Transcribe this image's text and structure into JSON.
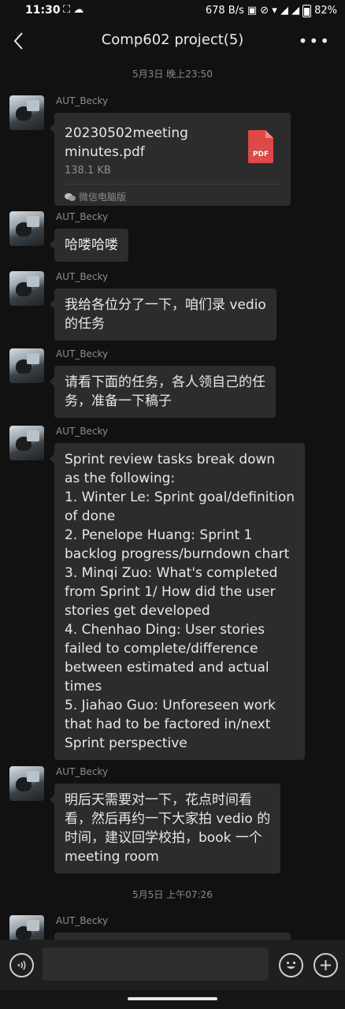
{
  "status_bar": {
    "time": "11:30",
    "left_icons": "⛶ ☁",
    "speed": "678 B/s",
    "battery": "82%"
  },
  "header": {
    "title": "Comp602 project(5)",
    "back_icon": "chevron-left-icon",
    "more_icon": "more-dots-icon"
  },
  "timestamps": [
    "5月3日 晚上23:50",
    "5月5日 上午07:26"
  ],
  "messages": [
    {
      "sender": "AUT_Becky",
      "type": "file",
      "file_name": "20230502meeting minutes.pdf",
      "file_size": "138.1 KB",
      "file_type": "PDF",
      "source": "微信电脑版"
    },
    {
      "sender": "AUT_Becky",
      "text": "哈喽哈喽"
    },
    {
      "sender": "AUT_Becky",
      "lines": [
        "我给各位分了一下，咱们录 vedio",
        "的任务"
      ]
    },
    {
      "sender": "AUT_Becky",
      "lines": [
        "请看下面的任务，各人领自己的任",
        "务，准备一下稿子"
      ]
    },
    {
      "sender": "AUT_Becky",
      "lines": [
        "Sprint review tasks break down",
        "as the following:",
        "1. Winter Le: Sprint goal/definition",
        "of done",
        "2. Penelope Huang: Sprint 1",
        "backlog progress/burndown chart",
        "3. Minqi Zuo: What's completed",
        "from Sprint 1/ How did the user",
        "stories get developed",
        "4. Chenhao Ding: User stories",
        "failed to complete/difference",
        "between estimated and actual",
        "times",
        "5. Jiahao Guo: Unforeseen work",
        "that had to be factored in/next",
        "Sprint perspective"
      ]
    },
    {
      "sender": "AUT_Becky",
      "lines": [
        "明后天需要对一下，花点时间看",
        "看，然后再约一下大家拍 vedio 的",
        "时间，建议回学校拍，book 一个",
        "meeting room"
      ]
    },
    {
      "sender": "AUT_Becky",
      "text": ""
    }
  ],
  "input_bar": {
    "voice_icon": "voice-icon",
    "emoji_icon": "emoji-icon",
    "plus_icon": "plus-icon"
  }
}
